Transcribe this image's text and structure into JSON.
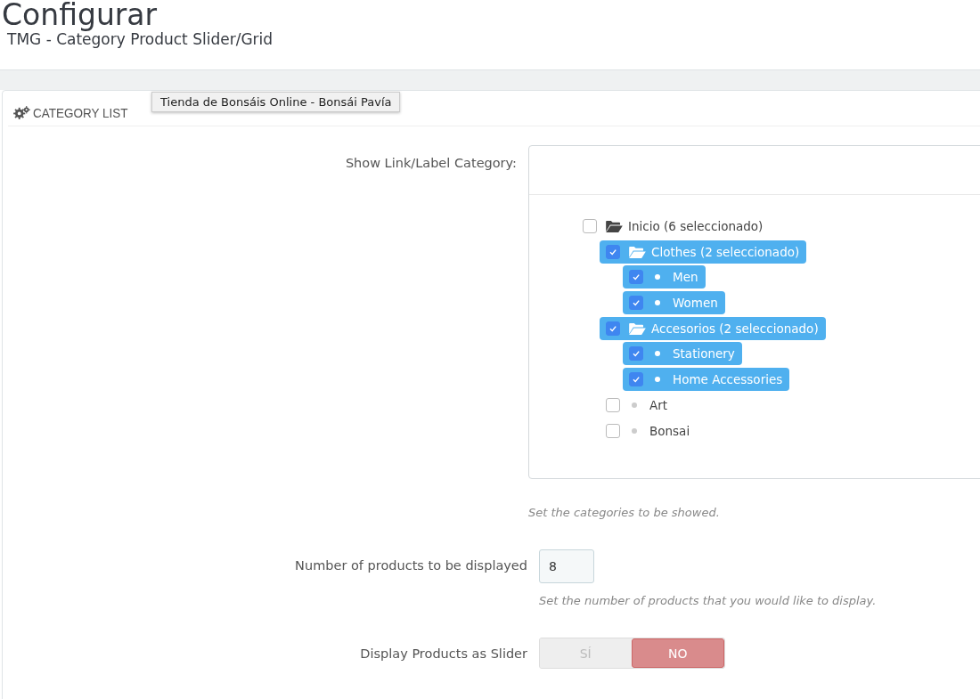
{
  "page": {
    "title": "Configurar",
    "subtitle": "TMG - Category Product Slider/Grid"
  },
  "tooltip": "Tienda de Bonsáis Online - Bonsái Pavía",
  "panel": {
    "title": "CATEGORY LIST"
  },
  "category_field": {
    "label": "Show Link/Label Category:",
    "help": "Set the categories to be showed.",
    "tree": [
      {
        "label": "Inicio (6 seleccionado)",
        "kind": "folder",
        "checked": false,
        "children": [
          {
            "label": "Clothes (2 seleccionado)",
            "kind": "folder",
            "checked": true,
            "children": [
              {
                "label": "Men",
                "kind": "leaf",
                "checked": true
              },
              {
                "label": "Women",
                "kind": "leaf",
                "checked": true
              }
            ]
          },
          {
            "label": "Accesorios (2 seleccionado)",
            "kind": "folder",
            "checked": true,
            "children": [
              {
                "label": "Stationery",
                "kind": "leaf",
                "checked": true
              },
              {
                "label": "Home Accessories",
                "kind": "leaf",
                "checked": true
              }
            ]
          },
          {
            "label": "Art",
            "kind": "leaf",
            "checked": false
          },
          {
            "label": "Bonsai",
            "kind": "leaf",
            "checked": false
          }
        ]
      }
    ]
  },
  "products_field": {
    "label": "Number of products to be displayed",
    "value": "8",
    "help": "Set the number of products that you would like to display."
  },
  "slider_field": {
    "label": "Display Products as Slider",
    "options": [
      {
        "label": "SÍ",
        "selected": false
      },
      {
        "label": "NO",
        "selected": true
      }
    ]
  }
}
